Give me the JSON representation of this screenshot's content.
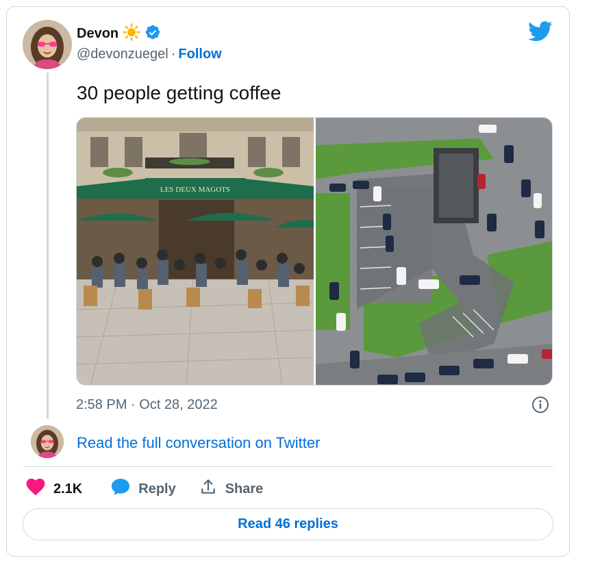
{
  "author": {
    "display_name": "Devon",
    "name_emoji": "sun",
    "verified": true,
    "handle": "@devonzuegel",
    "separator": "·",
    "follow_label": "Follow"
  },
  "tweet": {
    "text": "30 people getting coffee",
    "timestamp": "2:58 PM · Oct 28, 2022"
  },
  "media": {
    "photos": [
      {
        "sign_text": "LES DEUX MAGOTS"
      },
      {}
    ]
  },
  "conversation_link": "Read the full conversation on Twitter",
  "actions": {
    "like_count": "2.1K",
    "reply_label": "Reply",
    "share_label": "Share"
  },
  "read_replies_label": "Read 46 replies",
  "colors": {
    "twitter_blue": "#1d9bf0",
    "link_blue": "#006fd6",
    "like_pink": "#f91880",
    "muted_text": "#536471",
    "border": "#cfd9de"
  }
}
